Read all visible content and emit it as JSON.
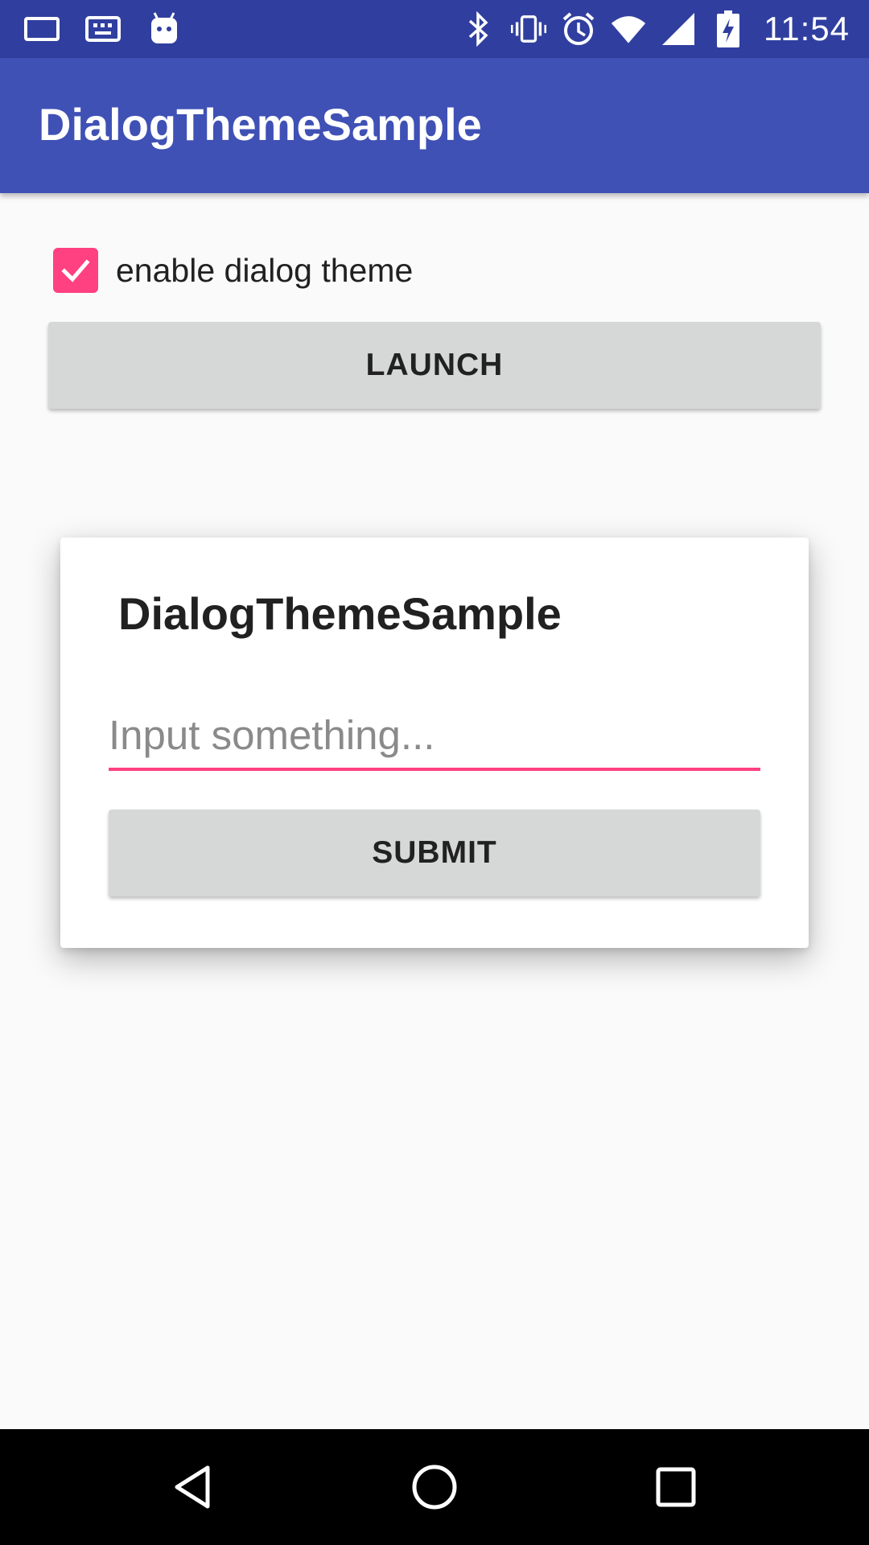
{
  "status_bar": {
    "time": "11:54",
    "icons_left": [
      "screen-icon",
      "keyboard-icon",
      "android-icon"
    ],
    "icons_right": [
      "bluetooth-icon",
      "vibrate-icon",
      "alarm-icon",
      "wifi-icon",
      "signal-icon",
      "battery-charging-icon"
    ],
    "background": "#303F9F"
  },
  "app_bar": {
    "title": "DialogThemeSample",
    "background": "#3F51B5"
  },
  "main": {
    "checkbox": {
      "label": "enable dialog theme",
      "checked": true,
      "accent": "#FF4081"
    },
    "launch_button": {
      "label": "LAUNCH"
    }
  },
  "dialog": {
    "title": "DialogThemeSample",
    "input": {
      "value": "",
      "placeholder": "Input something..."
    },
    "submit_button": {
      "label": "SUBMIT"
    }
  },
  "nav_bar": {
    "buttons": [
      "back-icon",
      "home-icon",
      "recents-icon"
    ]
  }
}
